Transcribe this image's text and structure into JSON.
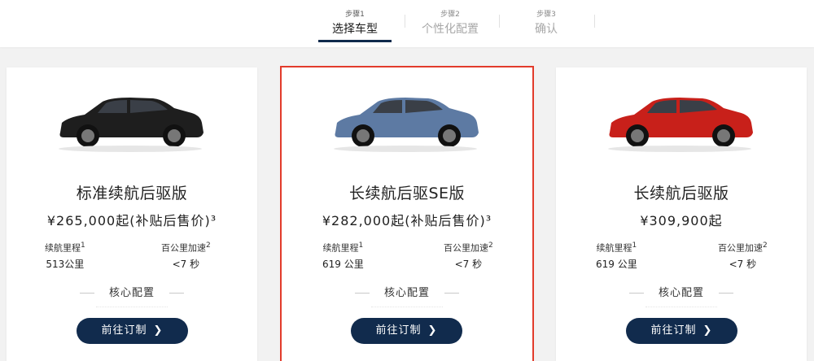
{
  "steps": [
    {
      "num": "步骤1",
      "label": "选择车型"
    },
    {
      "num": "步骤2",
      "label": "个性化配置"
    },
    {
      "num": "步骤3",
      "label": "确认"
    }
  ],
  "cards": [
    {
      "title": "标准续航后驱版",
      "price": "¥265,000起(补贴后售价)³",
      "range_label": "续航里程",
      "range_sup": "1",
      "range_value": "513公里",
      "accel_label": "百公里加速",
      "accel_sup": "2",
      "accel_value": "<7 秒",
      "core_label": "核心配置",
      "cta_label": "前往订制",
      "car_color": "#1e1e1e"
    },
    {
      "title": "长续航后驱SE版",
      "price": "¥282,000起(补贴后售价)³",
      "range_label": "续航里程",
      "range_sup": "1",
      "range_value": "619 公里",
      "accel_label": "百公里加速",
      "accel_sup": "2",
      "accel_value": "<7 秒",
      "core_label": "核心配置",
      "cta_label": "前往订制",
      "car_color": "#5d7aa3"
    },
    {
      "title": "长续航后驱版",
      "price": "¥309,900起",
      "range_label": "续航里程",
      "range_sup": "1",
      "range_value": "619 公里",
      "accel_label": "百公里加速",
      "accel_sup": "2",
      "accel_value": "<7 秒",
      "core_label": "核心配置",
      "cta_label": "前往订制",
      "car_color": "#c8201a"
    }
  ],
  "icons": {
    "chevron": "chevron-right-icon"
  },
  "colors": {
    "accent": "#112b4d",
    "selected_border": "#e23b2b"
  }
}
